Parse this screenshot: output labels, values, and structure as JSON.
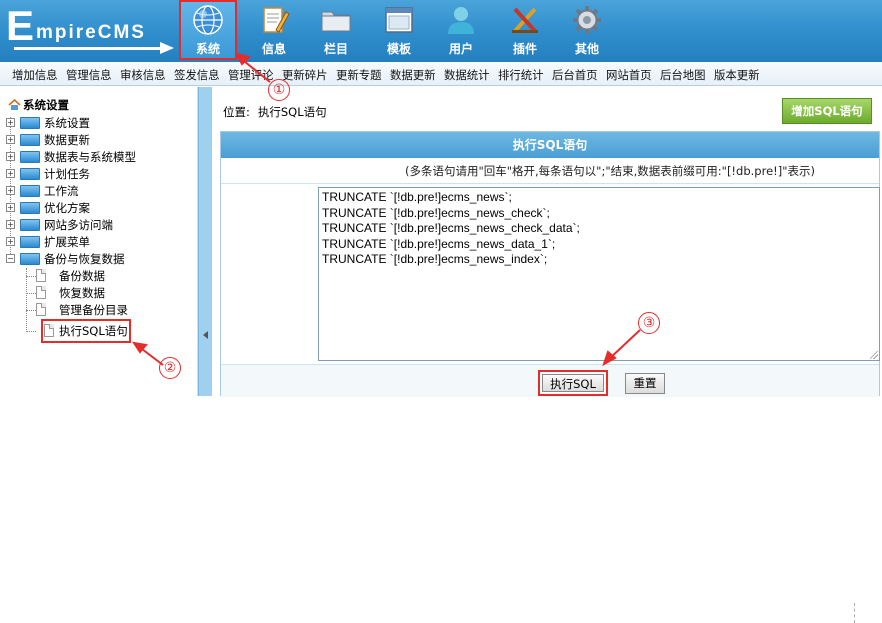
{
  "logo": {
    "big_letter": "E",
    "rest": "mpireCMS"
  },
  "nav": [
    {
      "label": "系统",
      "icon": "globe-icon",
      "active": true
    },
    {
      "label": "信息",
      "icon": "notepad-pencil-icon"
    },
    {
      "label": "栏目",
      "icon": "folder-icon"
    },
    {
      "label": "模板",
      "icon": "window-template-icon"
    },
    {
      "label": "用户",
      "icon": "user-icon"
    },
    {
      "label": "插件",
      "icon": "tools-icon"
    },
    {
      "label": "其他",
      "icon": "gear-icon"
    }
  ],
  "submenu": [
    "增加信息",
    "管理信息",
    "审核信息",
    "签发信息",
    "管理评论",
    "更新碎片",
    "更新专题",
    "数据更新",
    "数据统计",
    "排行统计",
    "后台首页",
    "网站首页",
    "后台地图",
    "版本更新"
  ],
  "sidebar": {
    "root": "系统设置",
    "folders": [
      "系统设置",
      "数据更新",
      "数据表与系统模型",
      "计划任务",
      "工作流",
      "优化方案",
      "网站多访问端",
      "扩展菜单",
      "备份与恢复数据"
    ],
    "children": [
      "备份数据",
      "恢复数据",
      "管理备份目录",
      "执行SQL语句"
    ]
  },
  "main": {
    "location_label": "位置:",
    "location_value": "执行SQL语句",
    "add_button": "增加SQL语句",
    "panel_title": "执行SQL语句",
    "note": "(多条语句请用\"回车\"格开,每条语句以\";\"结束,数据表前缀可用:\"[!db.pre!]\"表示)",
    "sql_lines": [
      "TRUNCATE `[!db.pre!]ecms_news`;",
      "TRUNCATE `[!db.pre!]ecms_news_check`;",
      "TRUNCATE `[!db.pre!]ecms_news_check_data`;",
      "TRUNCATE `[!db.pre!]ecms_news_data_1`;",
      "TRUNCATE `[!db.pre!]ecms_news_index`;"
    ],
    "run_button": "执行SQL",
    "reset_button": "重置"
  },
  "annotations": [
    "①",
    "②",
    "③"
  ],
  "colors": {
    "header": "#2f8dcc",
    "highlight": "#e62b2b",
    "add_button": "#6cab2c"
  }
}
